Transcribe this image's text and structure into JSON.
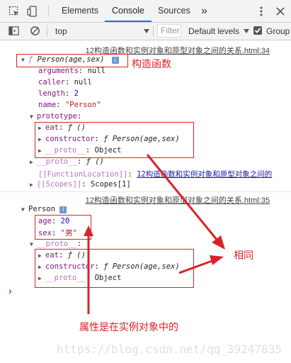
{
  "tabs": [
    {
      "label": "Elements"
    },
    {
      "label": "Console"
    },
    {
      "label": "Sources"
    }
  ],
  "more_tabs": "»",
  "toolbar": {
    "context": "top",
    "filter_placeholder": "Filter",
    "levels": "Default levels",
    "group_label": "Group"
  },
  "log1": {
    "source": "12构造函数和实例对象和原型对象之间的关系.html:34",
    "header_f": "ƒ",
    "header_sig": "Person(age,sex)",
    "arguments": {
      "key": "arguments",
      "val": "null"
    },
    "caller": {
      "key": "caller",
      "val": "null"
    },
    "length": {
      "key": "length",
      "val": "2"
    },
    "name": {
      "key": "name",
      "val": "\"Person\""
    },
    "prototype_key": "prototype",
    "proto_eat": {
      "key": "eat",
      "val": "ƒ ()"
    },
    "proto_constructor": {
      "key": "constructor",
      "val": "ƒ Person(age,sex)"
    },
    "proto_proto": {
      "key": "__proto__",
      "val": "Object"
    },
    "fn_proto": {
      "key": "__proto__",
      "val": "ƒ ()"
    },
    "fn_location": {
      "key": "[[FunctionLocation]]",
      "val": "12构造函数和实例对象和原型对象之间的"
    },
    "scopes": {
      "key": "[[Scopes]]",
      "val": "Scopes[1]"
    }
  },
  "log2": {
    "source": "12构造函数和实例对象和原型对象之间的关系.html:35",
    "header": "Person",
    "age": {
      "key": "age",
      "val": "20"
    },
    "sex": {
      "key": "sex",
      "val": "\"男\""
    },
    "proto_key": "__proto__",
    "eat": {
      "key": "eat",
      "val": "ƒ ()"
    },
    "constructor": {
      "key": "constructor",
      "val": "ƒ Person(age,sex)"
    },
    "proto_proto": {
      "key": "__proto__",
      "val": "Object"
    }
  },
  "prompt": "›",
  "annotations": {
    "constructor_label": "构造函数",
    "same_label": "相同",
    "property_label": "属性是在实例对象中的"
  },
  "watermark": "https://blog.csdn.net/qq_39247835",
  "colors": {
    "annotation": "#d9232a",
    "active_tab": "#1a73e8"
  }
}
